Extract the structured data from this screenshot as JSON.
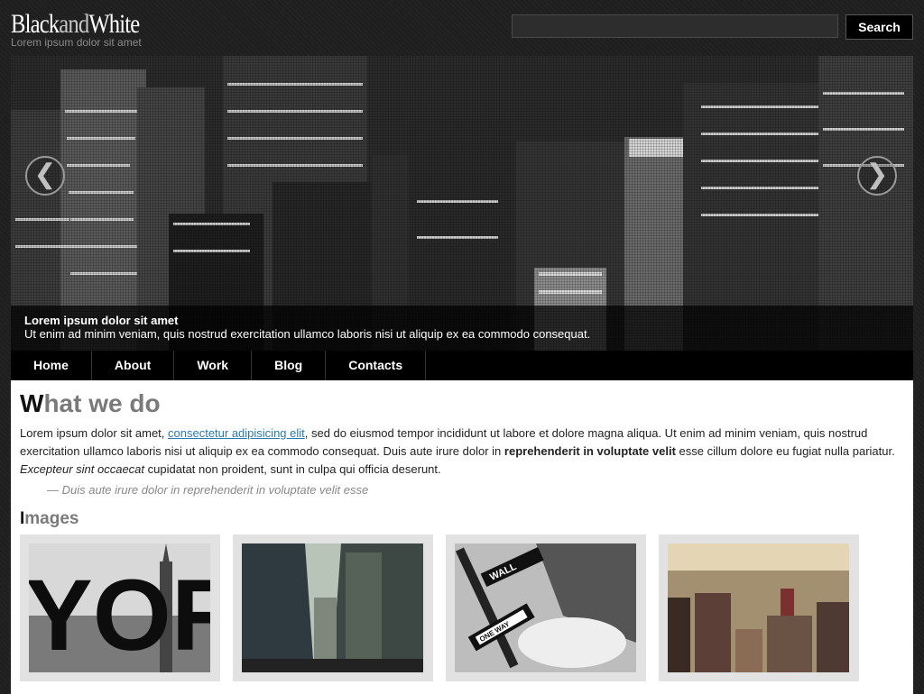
{
  "header": {
    "logo_part1": "Black",
    "logo_part2": "and",
    "logo_part3": "White",
    "tagline": "Lorem ipsum dolor sit amet",
    "search_value": "",
    "search_button": "Search"
  },
  "slider": {
    "prev_icon": "❮",
    "next_icon": "❯",
    "caption_title": "Lorem ipsum dolor sit amet",
    "caption_text": "Ut enim ad minim veniam, quis nostrud exercitation ullamco laboris nisi ut aliquip ex ea commodo consequat."
  },
  "nav": {
    "items": [
      {
        "label": "Home"
      },
      {
        "label": "About"
      },
      {
        "label": "Work"
      },
      {
        "label": "Blog"
      },
      {
        "label": "Contacts"
      }
    ]
  },
  "main": {
    "heading_first": "W",
    "heading_rest": "hat we do",
    "p1": "Lorem ipsum dolor sit amet, ",
    "link": "consectetur adipisicing elit",
    "p2": ", sed do eiusmod tempor incididunt ut labore et dolore magna aliqua. Ut enim ad minim veniam, quis nostrud exercitation ullamco laboris nisi ut aliquip ex ea commodo consequat. Duis aute irure dolor in ",
    "bold": "reprehenderit in voluptate velit",
    "p3": " esse cillum dolore eu fugiat nulla pariatur. ",
    "italic": "Excepteur sint occaecat",
    "p4": " cupidatat non proident, sunt in culpa qui officia deserunt.",
    "quote": "— Duis aute irure dolor in reprehenderit in voluptate velit esse",
    "images_heading_first": "I",
    "images_heading_rest": "mages",
    "thumb1_text": "YOR",
    "thumb3_sign1": "WALL",
    "thumb3_sign2": "ONE WAY"
  },
  "colors": {
    "accent_link": "#2a7ab0",
    "nav_bg": "#000000",
    "heading_grey": "#7a7a7a"
  }
}
